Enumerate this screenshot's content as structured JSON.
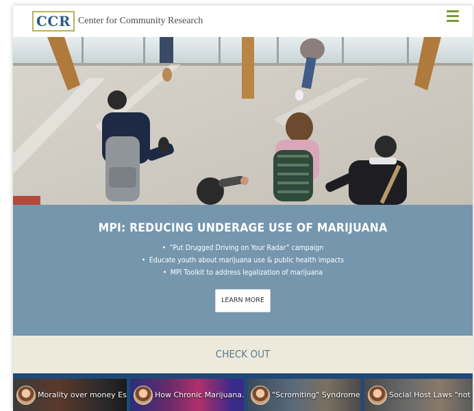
{
  "header": {
    "logo_abbr": "CCR",
    "logo_text": "Center for Community Research",
    "menu_icon": "hamburger-menu-icon",
    "accent_color": "#7a9a2e"
  },
  "hero": {
    "image_alt": "Students walking in a school hallway"
  },
  "banner": {
    "title": "MPI: REDUCING UNDERAGE USE OF MARIJUANA",
    "bullets": [
      "“Put Drugged Driving on Your Radar” campaign",
      "Educate youth about marijuana use & public health impacts",
      "MPI Toolkit to address legalization of marijuana"
    ],
    "button_label": "LEARN MORE",
    "background_color": "#7596ad"
  },
  "checkout": {
    "title": "CHECK OUT",
    "background_color": "#eeeadb"
  },
  "videos": [
    {
      "title": "Morality over money Es..."
    },
    {
      "title": "How Chronic Marijuana..."
    },
    {
      "title": "\"Scromiting\" Syndrome..."
    },
    {
      "title": "Social Host Laws \"not j..."
    }
  ]
}
